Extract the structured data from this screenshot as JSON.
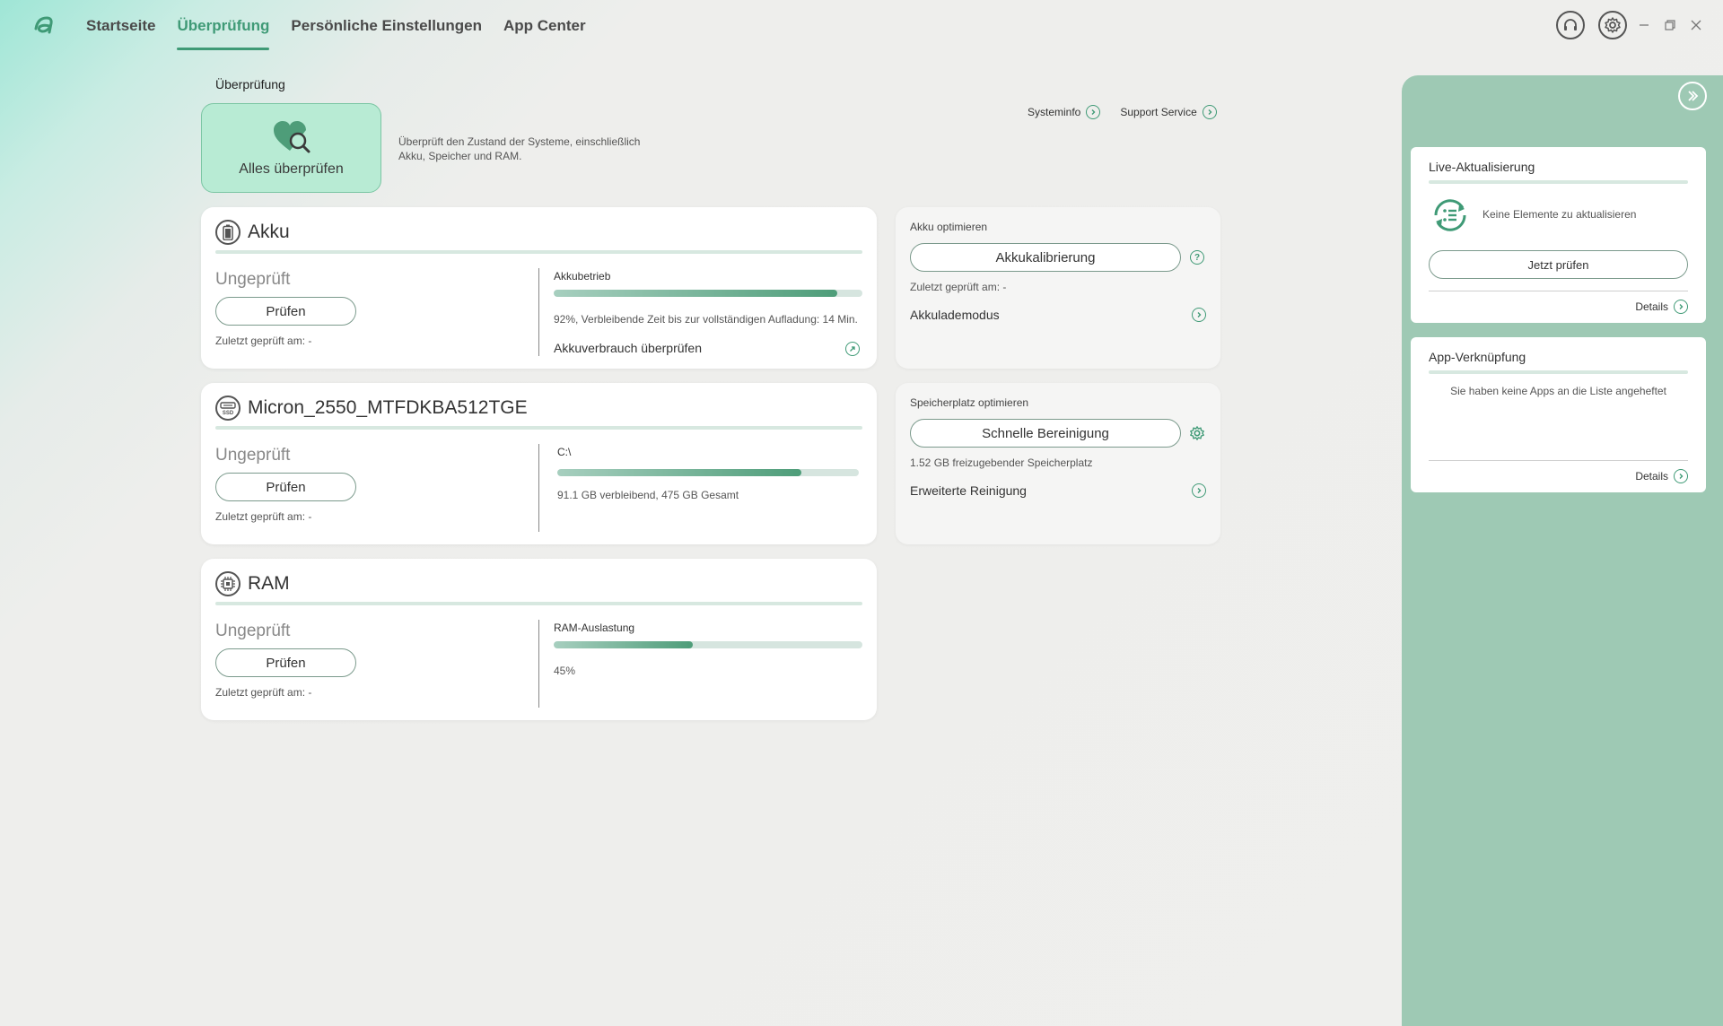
{
  "nav": {
    "items": [
      "Startseite",
      "Überprüfung",
      "Persönliche Einstellungen",
      "App Center"
    ],
    "active_index": 1
  },
  "header": {
    "title": "Überprüfung",
    "check_all_label": "Alles überprüfen",
    "description": "Überprüft den Zustand der Systeme, einschließlich Akku, Speicher und RAM.",
    "sysinfo_link": "Systeminfo",
    "support_link": "Support Service"
  },
  "battery": {
    "title": "Akku",
    "status": "Ungeprüft",
    "check_button": "Prüfen",
    "last_checked": "Zuletzt geprüft am: -",
    "metric_label": "Akkubetrieb",
    "level_percent": 92,
    "metric_text": "92%, Verbleibende Zeit bis zur vollständigen Aufladung: 14 Min.",
    "usage_link": "Akkuverbrauch überprüfen"
  },
  "storage": {
    "title": "Micron_2550_MTFDKBA512TGE",
    "status": "Ungeprüft",
    "check_button": "Prüfen",
    "last_checked": "Zuletzt geprüft am: -",
    "drive_label": "C:\\",
    "used_percent": 81,
    "metric_text": "91.1 GB verbleibend, 475 GB Gesamt"
  },
  "ram": {
    "title": "RAM",
    "status": "Ungeprüft",
    "check_button": "Prüfen",
    "last_checked": "Zuletzt geprüft am: -",
    "metric_label": "RAM-Auslastung",
    "usage_percent": 45,
    "metric_text": "45%"
  },
  "battery_opt": {
    "title": "Akku optimieren",
    "calibration_button": "Akkukalibrierung",
    "last_checked": "Zuletzt geprüft am: -",
    "mode_link": "Akkulademodus"
  },
  "storage_opt": {
    "title": "Speicherplatz optimieren",
    "quick_clean_button": "Schnelle Bereinigung",
    "freeable_text": "1.52 GB freizugebender Speicherplatz",
    "advanced_link": "Erweiterte Reinigung"
  },
  "live_update": {
    "title": "Live-Aktualisierung",
    "message": "Keine Elemente zu aktualisieren",
    "check_now_button": "Jetzt prüfen",
    "details_link": "Details"
  },
  "app_shortcut": {
    "title": "App-Verknüpfung",
    "message": "Sie haben keine Apps an die Liste angeheftet",
    "details_link": "Details"
  },
  "colors": {
    "accent": "#3f9a76",
    "panel": "#9ec9b4",
    "check_all_bg": "#b8ebd4"
  }
}
